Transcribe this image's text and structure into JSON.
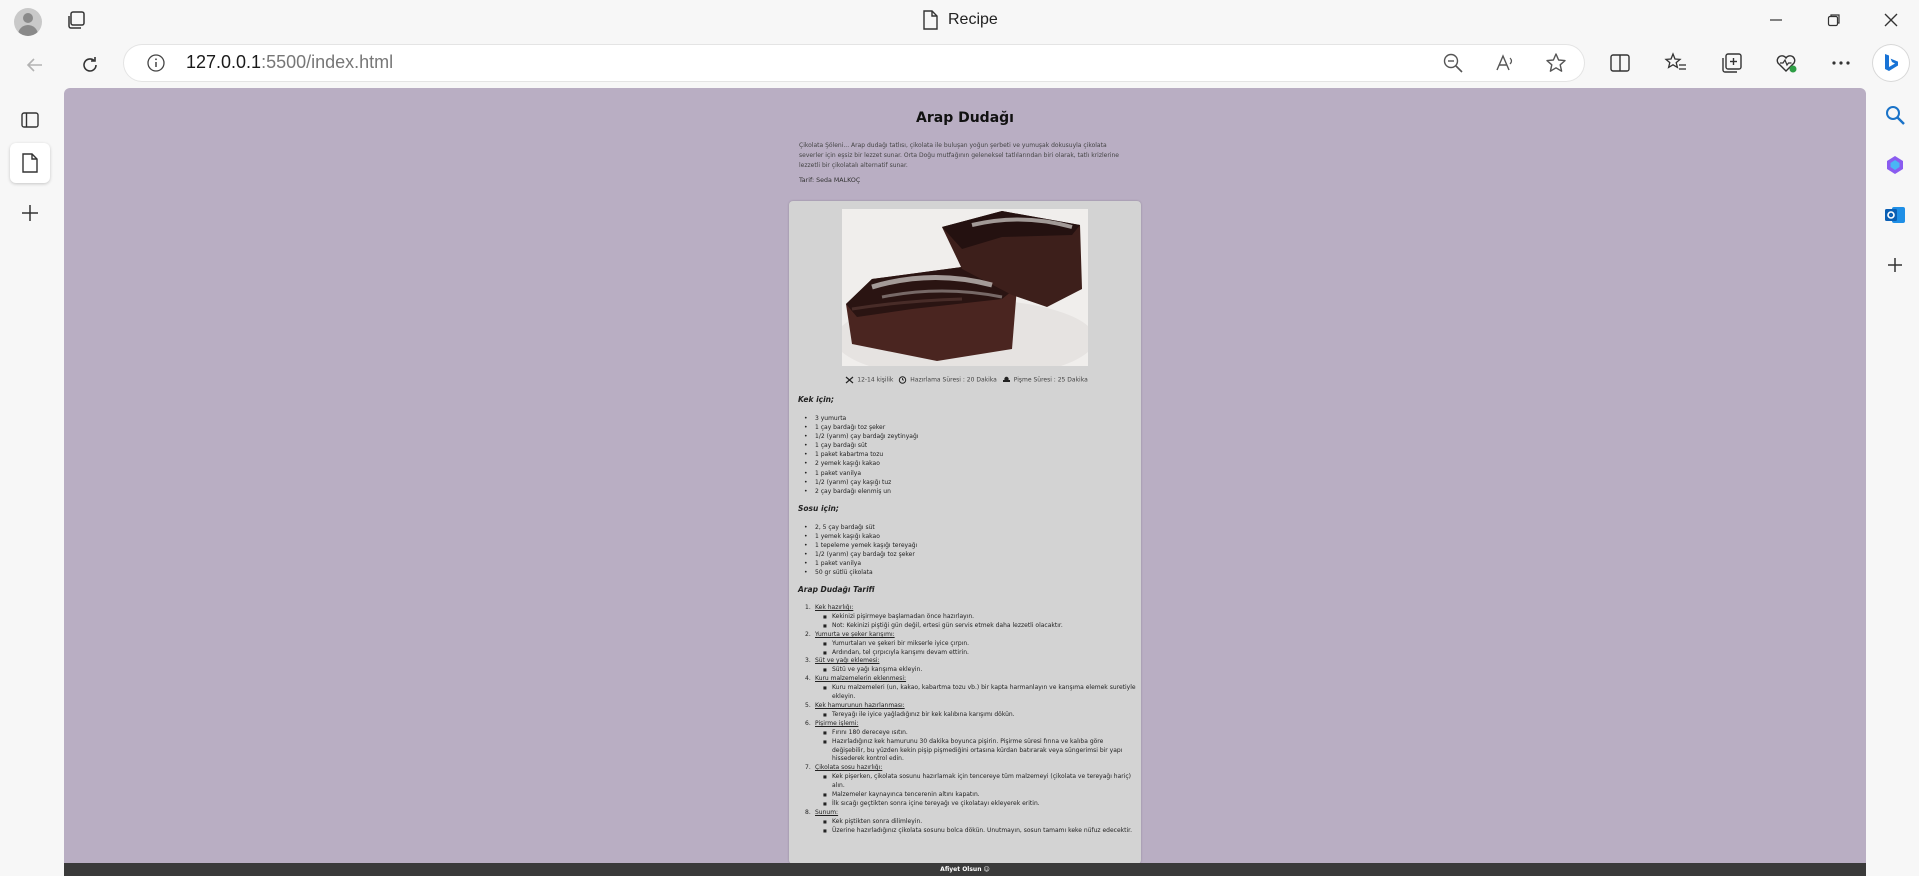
{
  "browser": {
    "tab_title": "Recipe",
    "url_host": "127.0.0.1",
    "url_path": ":5500/index.html"
  },
  "recipe": {
    "title": "Arap Dudağı",
    "intro": "Çikolata Şöleni... Arap dudağı tatlısı, çikolata ile buluşan yoğun şerbeti ve yumuşak dokusuyla çikolata severler için eşsiz bir lezzet sunar. Orta Doğu mutfağının geleneksel tatlılarından biri olarak, tatlı krizlerine lezzetli bir çikolatalı alternatif sunar.",
    "author": "Tarif: Seda MALKOÇ",
    "meta": {
      "servings": "12-14 kişilik",
      "prep": "Hazırlama Süresi : 20 Dakika",
      "cook": "Pişme Süresi : 25 Dakika"
    },
    "cake_heading": "Kek için;",
    "cake_ingredients": [
      "3 yumurta",
      "1 çay bardağı toz şeker",
      "1/2 (yarım) çay bardağı zeytinyağı",
      "1 çay bardağı süt",
      "1 paket kabartma tozu",
      "2 yemek kaşığı kakao",
      "1 paket vanilya",
      "1/2 (yarım) çay kaşığı tuz",
      "2 çay bardağı elenmiş un"
    ],
    "sauce_heading": "Sosu için;",
    "sauce_ingredients": [
      "2, 5 çay bardağı süt",
      "1 yemek kaşığı kakao",
      "1 tepeleme yemek kaşığı tereyağı",
      "1/2 (yarım) çay bardağı toz şeker",
      "1 paket vanilya",
      "50 gr sütlü çikolata"
    ],
    "steps_heading": "Arap Dudağı Tarifi",
    "steps": [
      {
        "num": "1.",
        "title": "Kek hazırlığı:",
        "notes": [
          "Kekinizi pişirmeye başlamadan önce hazırlayın.",
          "Not: Kekinizi piştiği gün değil, ertesi gün servis etmek daha lezzetli olacaktır."
        ]
      },
      {
        "num": "2.",
        "title": "Yumurta ve şeker karışımı:",
        "notes": [
          "Yumurtaları ve şekeri bir mikserle iyice çırpın.",
          "Ardından, tel çırpıcıyla karışımı devam ettirin."
        ]
      },
      {
        "num": "3.",
        "title": "Süt ve yağı eklemesi:",
        "notes": [
          "Sütü ve yağı karışıma ekleyin."
        ]
      },
      {
        "num": "4.",
        "title": "Kuru malzemelerin eklenmesi:",
        "notes": [
          "Kuru malzemeleri (un, kakao, kabartma tozu vb.) bir kapta harmanlayın ve karışıma elemek suretiyle ekleyin."
        ]
      },
      {
        "num": "5.",
        "title": "Kek hamurunun hazırlanması:",
        "notes": [
          "Tereyağı ile iyice yağladığınız bir kek kalıbına karışımı dökün."
        ]
      },
      {
        "num": "6.",
        "title": "Pişirme işlemi:",
        "notes": [
          "Fırını 180 dereceye ısıtın.",
          "Hazırladığınız kek hamurunu 30 dakika boyunca pişirin. Pişirme süresi fırına ve kalıba göre değişebilir, bu yüzden kekin pişip pişmediğini ortasına kürdan batırarak veya süngerimsi bir yapı hissederek kontrol edin."
        ]
      },
      {
        "num": "7.",
        "title": "Çikolata sosu hazırlığı:",
        "notes": [
          "Kek pişerken, çikolata sosunu hazırlamak için tencereye tüm malzemeyi (çikolata ve tereyağı hariç) alın.",
          "Malzemeler kaynayınca tencerenin altını kapatın.",
          "İlk sıcağı geçtikten sonra içine tereyağı ve çikolatayı ekleyerek eritin."
        ]
      },
      {
        "num": "8.",
        "title": "Sunum:",
        "notes": [
          "Kek piştikten sonra dilimleyin.",
          "Üzerine hazırladığınız çikolata sosunu bolca dökün. Unutmayın, sosun tamamı keke nüfuz edecektir."
        ]
      }
    ]
  },
  "footer": {
    "text": "Afiyet Olsun ☺"
  }
}
